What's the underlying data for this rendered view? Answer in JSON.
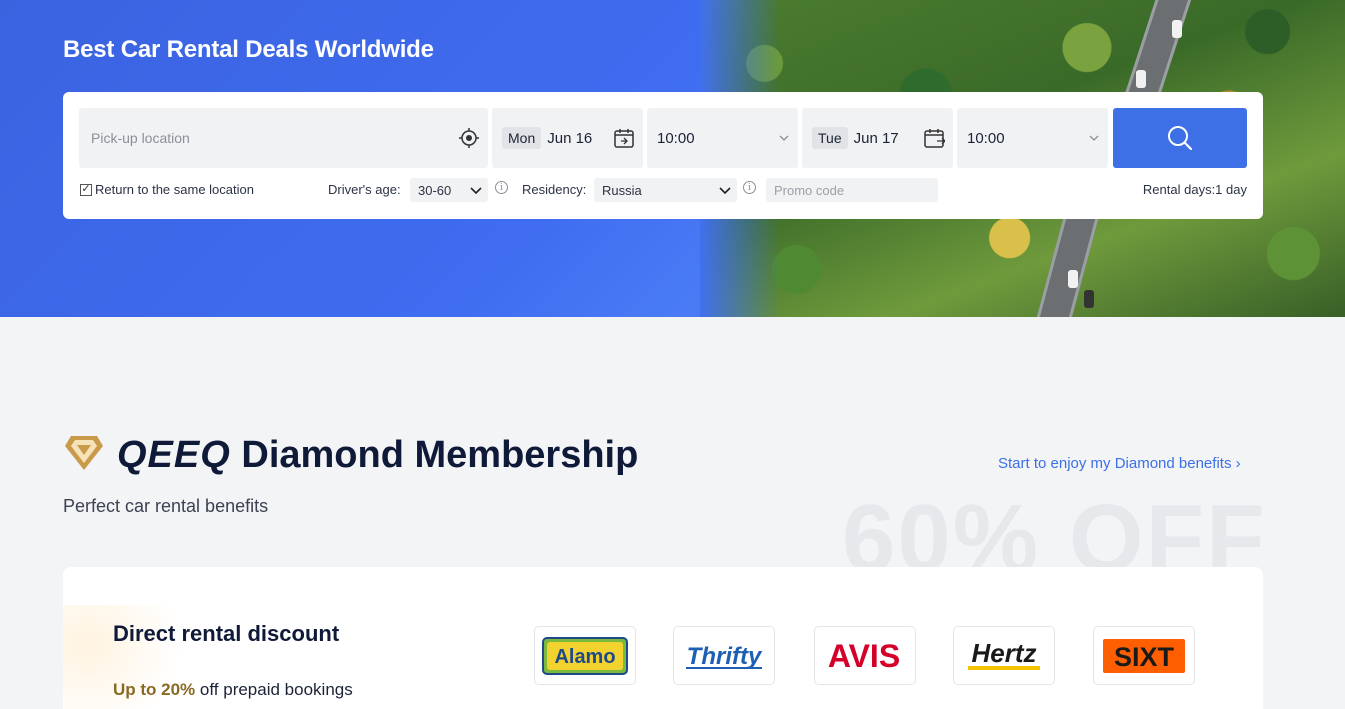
{
  "hero": {
    "title": "Best Car Rental Deals Worldwide"
  },
  "search": {
    "pickup_placeholder": "Pick-up location",
    "pickup_date": {
      "day": "Mon",
      "date": "Jun 16"
    },
    "pickup_time": "10:00",
    "dropoff_date": {
      "day": "Tue",
      "date": "Jun 17"
    },
    "dropoff_time": "10:00",
    "return_same_location": {
      "label": "Return to the same location",
      "checked": true
    },
    "driver_age": {
      "label": "Driver's age:",
      "value": "30-60"
    },
    "residency": {
      "label": "Residency:",
      "value": "Russia"
    },
    "promo_placeholder": "Promo code",
    "rental_days": "Rental days:1 day",
    "accent_color": "#3d6fe6"
  },
  "membership": {
    "brand": "QEEQ",
    "title_rest": "Diamond Membership",
    "subtitle": "Perfect car rental benefits",
    "benefits_link": "Start to enjoy my Diamond benefits",
    "watermark": "60% OFF",
    "card": {
      "title": "Direct rental discount",
      "highlight": "Up to 20%",
      "rest": "off prepaid bookings"
    },
    "partners": [
      "Alamo",
      "Thrifty",
      "AVIS",
      "Hertz",
      "SIXT"
    ]
  }
}
